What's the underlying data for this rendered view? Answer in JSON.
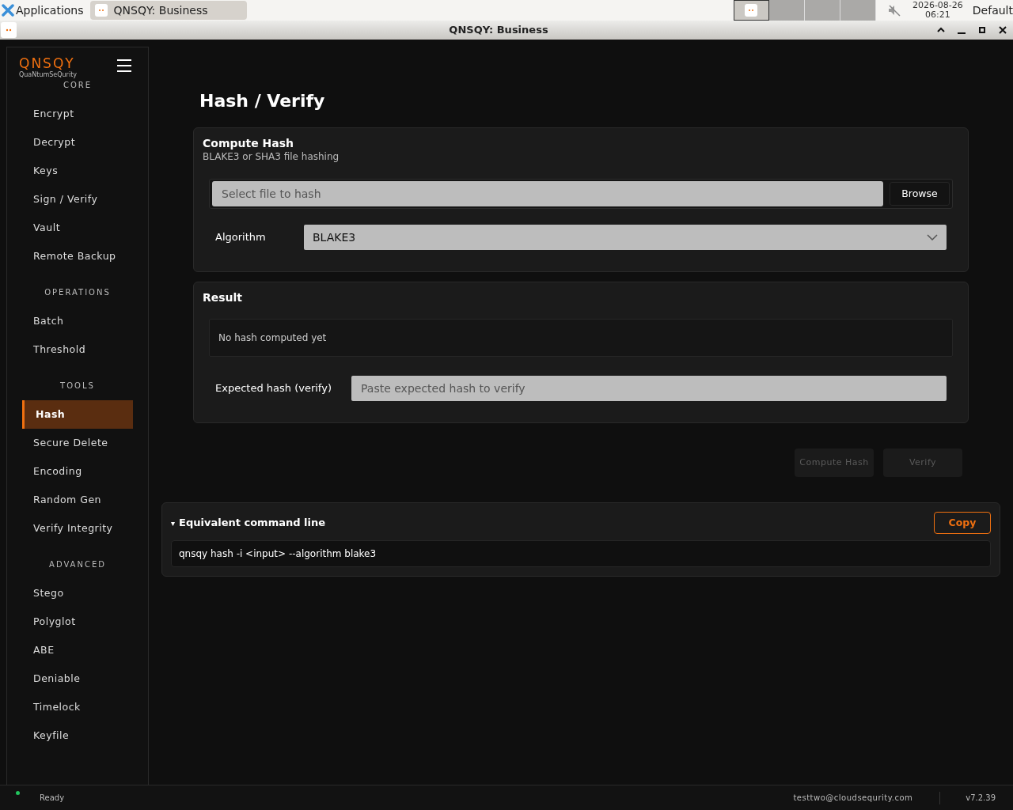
{
  "taskbar": {
    "applications_label": "Applications",
    "window_button": "QNSQY: Business",
    "workspaces": [
      {
        "selected": true
      },
      {
        "selected": false
      },
      {
        "selected": false
      },
      {
        "selected": false
      }
    ],
    "muted": true,
    "clock_date": "2026-08-26",
    "clock_time": "06:21",
    "layout_label": "Default"
  },
  "window": {
    "title": "QNSQY: Business"
  },
  "sidebar": {
    "logo": "QNSQY",
    "tagline": "QuaNtumSeQurity",
    "sections": [
      {
        "heading": "CORE",
        "items": [
          {
            "label": "Encrypt",
            "selected": false
          },
          {
            "label": "Decrypt",
            "selected": false
          },
          {
            "label": "Keys",
            "selected": false
          },
          {
            "label": "Sign / Verify",
            "selected": false
          },
          {
            "label": "Vault",
            "selected": false
          },
          {
            "label": "Remote Backup",
            "selected": false
          }
        ]
      },
      {
        "heading": "OPERATIONS",
        "items": [
          {
            "label": "Batch",
            "selected": false
          },
          {
            "label": "Threshold",
            "selected": false
          }
        ]
      },
      {
        "heading": "TOOLS",
        "items": [
          {
            "label": "Hash",
            "selected": true
          },
          {
            "label": "Secure Delete",
            "selected": false
          },
          {
            "label": "Encoding",
            "selected": false
          },
          {
            "label": "Random Gen",
            "selected": false
          },
          {
            "label": "Verify Integrity",
            "selected": false
          }
        ]
      },
      {
        "heading": "ADVANCED",
        "items": [
          {
            "label": "Stego",
            "selected": false
          },
          {
            "label": "Polyglot",
            "selected": false
          },
          {
            "label": "ABE",
            "selected": false
          },
          {
            "label": "Deniable",
            "selected": false
          },
          {
            "label": "Timelock",
            "selected": false
          },
          {
            "label": "Keyfile",
            "selected": false
          }
        ]
      }
    ]
  },
  "page_title": "Hash / Verify",
  "compute_card": {
    "title": "Compute Hash",
    "subtitle": "BLAKE3 or SHA3 file hashing",
    "file_placeholder": "Select file to hash",
    "browse_button": "Browse",
    "algorithm_label": "Algorithm",
    "algorithm_value": "BLAKE3"
  },
  "result_card": {
    "title": "Result",
    "result_text": "No hash computed yet",
    "expected_label": "Expected hash (verify)",
    "expected_placeholder": "Paste expected hash to verify"
  },
  "actions": [
    {
      "label": "Compute Hash",
      "disabled": true
    },
    {
      "label": "Verify",
      "disabled": true
    }
  ],
  "command_panel": {
    "expanded": true,
    "toggle": "▾",
    "title": "Equivalent command line",
    "copy_button": "Copy",
    "command": "qnsqy hash -i <input> --algorithm blake3"
  },
  "status_bar": {
    "connected": true,
    "status": "Ready",
    "user": "testtwo@cloudsequrity.com",
    "version": "v7.2.39"
  }
}
